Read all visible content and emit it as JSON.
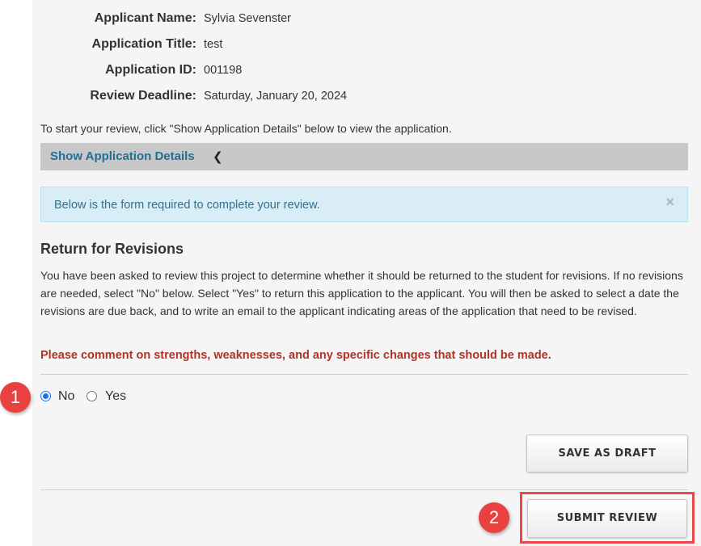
{
  "applicant": {
    "fields": [
      {
        "label": "Applicant Name:",
        "value": "Sylvia Sevenster"
      },
      {
        "label": "Application Title:",
        "value": "test"
      },
      {
        "label": "Application ID:",
        "value": "001198"
      },
      {
        "label": "Review Deadline:",
        "value": "Saturday, January 20, 2024"
      }
    ]
  },
  "intro_text": "To start your review, click \"Show Application Details\" below to view the application.",
  "details": {
    "link_label": "Show Application Details",
    "chevron": "❮",
    "chevron_icon": "chevron-left-icon"
  },
  "alert": {
    "text": "Below is the form required to complete your review.",
    "close": "×"
  },
  "section": {
    "title": "Return for Revisions",
    "body": "You have been asked to review this project to determine whether it should be returned to the student for revisions. If no revisions are needed, select \"No\" below. Select \"Yes\" to return this application to the applicant. You will then be asked to select a date the revisions are due back, and to write an email to the applicant indicating areas of the application that need to be revised.",
    "warning": "Please comment on strengths, weaknesses, and any specific changes that should be made."
  },
  "radios": {
    "selected": "No",
    "options": [
      {
        "label": "No",
        "checked": true
      },
      {
        "label": "Yes",
        "checked": false
      }
    ]
  },
  "buttons": {
    "save_draft": "SAVE AS DRAFT",
    "submit": "SUBMIT REVIEW"
  },
  "annotations": {
    "step1": "1",
    "step2": "2",
    "color": "#e8413f"
  },
  "colors": {
    "link": "#1f6f93",
    "alert_bg": "#d9edf7",
    "alert_text": "#31708f",
    "warning": "#b03326",
    "radio_accent": "#1a73e8"
  }
}
